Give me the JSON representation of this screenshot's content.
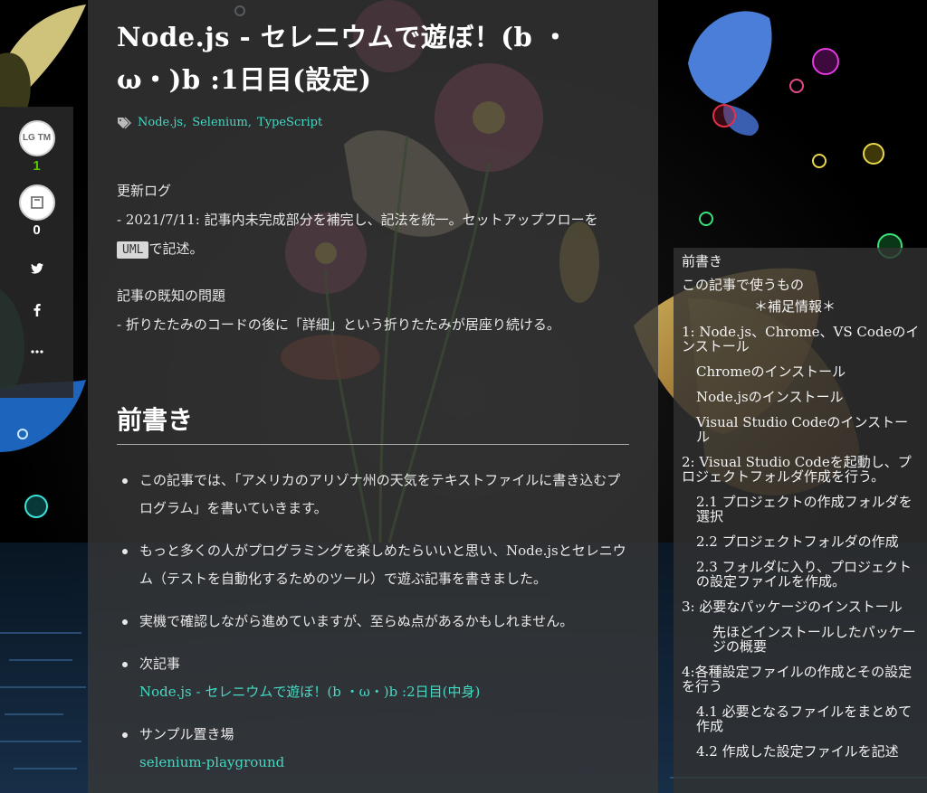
{
  "article": {
    "title": "Node.js - セレニウムで遊ぼ！(b ・ω・)b :1日目(設定)",
    "tags": [
      "Node.js",
      "Selenium",
      "TypeScript"
    ],
    "update_log": {
      "heading": "更新ログ",
      "entry_prefix": "- 2021/7/11: 記事内未完成部分を補完し、記法を統一。セットアップフローを",
      "code": "UML",
      "entry_suffix": "で記述。"
    },
    "known_issues": {
      "heading": "記事の既知の問題",
      "entry": "- 折りたたみのコードの後に「詳細」という折りたたみが居座り続ける。"
    },
    "section_heading": "前書き",
    "bullets": [
      "この記事では、「アメリカのアリゾナ州の天気をテキストファイルに書き込むプログラム」を書いていきます。",
      "もっと多くの人がプログラミングを楽しめたらいいと思い、Node.jsとセレニウム（テストを自動化するためのツール）で遊ぶ記事を書きました。",
      "実機で確認しながら進めていますが、至らぬ点があるかもしれません。"
    ],
    "next_article": {
      "label": "次記事",
      "link": "Node.js - セレニウムで遊ぼ！(b ・ω・)b :2日目(中身)"
    },
    "sample": {
      "label": "サンプル置き場",
      "link": "selenium-playground"
    }
  },
  "actions": {
    "lgtm_label": "LG TM",
    "lgtm_count": "1",
    "stock_count": "0"
  },
  "toc": {
    "heading": "前書き",
    "items": [
      {
        "label": "この記事で使うもの",
        "level": "l1"
      },
      {
        "label": "＊補足情報＊",
        "level": "center"
      },
      {
        "label": "1: Node.js、Chrome、VS Codeのインストール",
        "level": "l1"
      },
      {
        "label": "Chromeのインストール",
        "level": "l2"
      },
      {
        "label": "Node.jsのインストール",
        "level": "l2"
      },
      {
        "label": "Visual Studio Codeのインストール",
        "level": "l2"
      },
      {
        "label": "2: Visual Studio Codeを起動し、プロジェクトフォルダ作成を行う。",
        "level": "l1"
      },
      {
        "label": "2.1 プロジェクトの作成フォルダを選択",
        "level": "l2"
      },
      {
        "label": "2.2 プロジェクトフォルダの作成",
        "level": "l2"
      },
      {
        "label": "2.3 フォルダに入り、プロジェクトの設定ファイルを作成。",
        "level": "l2"
      },
      {
        "label": "3: 必要なパッケージのインストール",
        "level": "l1"
      },
      {
        "label": "先ほどインストールしたパッケージの概要",
        "level": "l3"
      },
      {
        "label": "4:各種設定ファイルの作成とその設定を行う",
        "level": "l1"
      },
      {
        "label": "4.1 必要となるファイルをまとめて作成",
        "level": "l2"
      },
      {
        "label": "4.2 作成した設定ファイルを記述",
        "level": "l2"
      }
    ]
  },
  "colors": {
    "link": "#44d9c3",
    "lgtm_count": "#55c500"
  }
}
